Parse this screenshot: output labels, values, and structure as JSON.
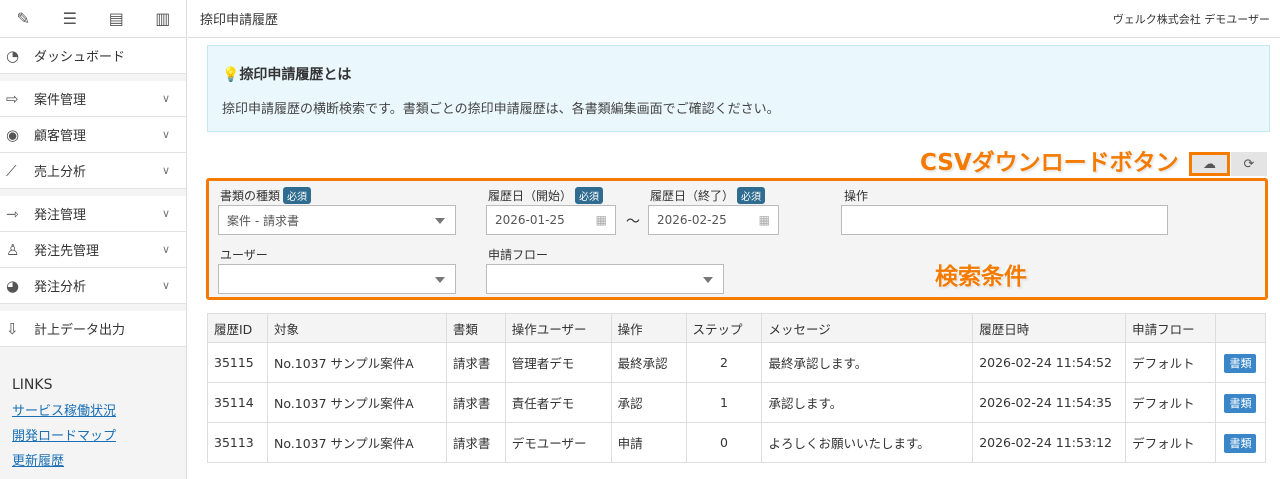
{
  "sidebar": {
    "dashboard": "ダッシュボード",
    "items": [
      {
        "label": "案件管理"
      },
      {
        "label": "顧客管理"
      },
      {
        "label": "売上分析"
      },
      {
        "label": "発注管理"
      },
      {
        "label": "発注先管理"
      },
      {
        "label": "発注分析"
      }
    ],
    "export": "計上データ出力",
    "links_title": "LINKS",
    "links": [
      "サービス稼働状況",
      "開発ロードマップ",
      "更新履歴"
    ]
  },
  "header": {
    "title": "捺印申請履歴",
    "user": "ヴェルク株式会社 デモユーザー"
  },
  "info": {
    "title": "捺印申請履歴とは",
    "text": "捺印申請履歴の横断検索です。書類ごとの捺印申請履歴は、各書類編集画面でご確認ください。"
  },
  "annotations": {
    "csv": "CSVダウンロードボタン",
    "search": "検索条件"
  },
  "search": {
    "doc_type_label": "書類の種類",
    "required": "必須",
    "doc_type_value": "案件 - 請求書",
    "date_start_label": "履歴日（開始）",
    "date_start": "2026-01-25",
    "tilde": "〜",
    "date_end_label": "履歴日（終了）",
    "date_end": "2026-02-25",
    "operation_label": "操作",
    "operation_value": "",
    "user_label": "ユーザー",
    "flow_label": "申請フロー"
  },
  "table": {
    "headers": [
      "履歴ID",
      "対象",
      "書類",
      "操作ユーザー",
      "操作",
      "ステップ",
      "メッセージ",
      "履歴日時",
      "申請フロー",
      ""
    ],
    "rows": [
      {
        "id": "35115",
        "target": "No.1037 サンプル案件A",
        "doc": "請求書",
        "user": "管理者デモ",
        "op": "最終承認",
        "step": "2",
        "msg": "最終承認します。",
        "date": "2026-02-24 11:54:52",
        "flow": "デフォルト",
        "btn": "書類"
      },
      {
        "id": "35114",
        "target": "No.1037 サンプル案件A",
        "doc": "請求書",
        "user": "責任者デモ",
        "op": "承認",
        "step": "1",
        "msg": "承認します。",
        "date": "2026-02-24 11:54:35",
        "flow": "デフォルト",
        "btn": "書類"
      },
      {
        "id": "35113",
        "target": "No.1037 サンプル案件A",
        "doc": "請求書",
        "user": "デモユーザー",
        "op": "申請",
        "step": "0",
        "msg": "よろしくお願いいたします。",
        "date": "2026-02-24 11:53:12",
        "flow": "デフォルト",
        "btn": "書類"
      }
    ]
  }
}
